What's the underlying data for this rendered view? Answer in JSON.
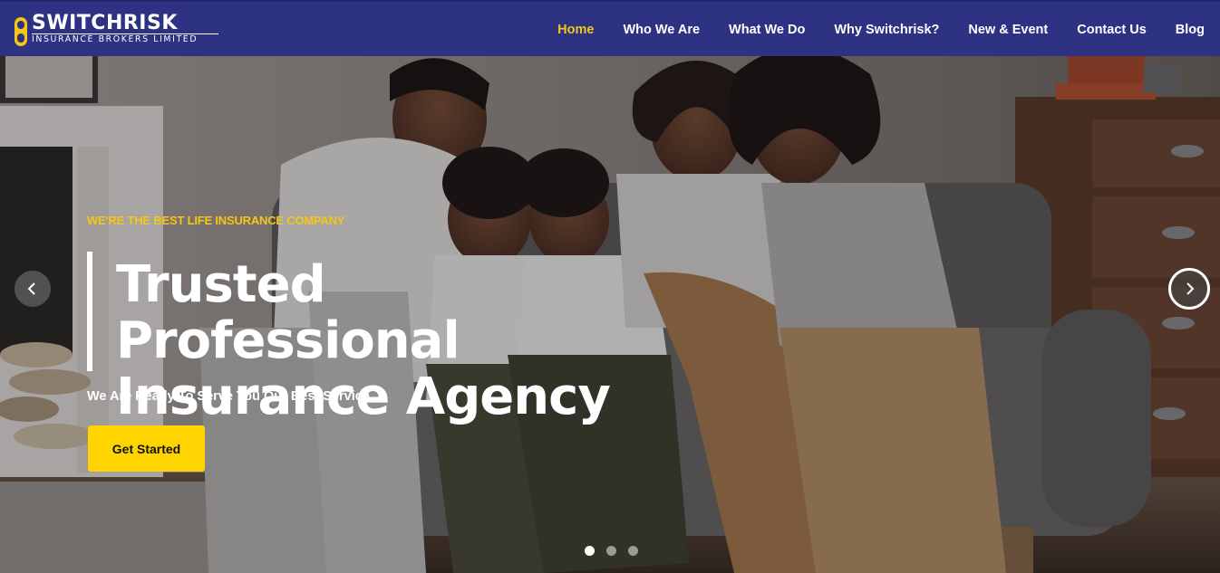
{
  "brand": {
    "name": "SWITCHRISK",
    "subtitle": "INSURANCE BROKERS LIMITED",
    "colors": {
      "navbar": "#2d3282",
      "accent": "#f5c518",
      "cta": "#ffd400"
    }
  },
  "nav": {
    "items": [
      {
        "label": "Home",
        "active": true
      },
      {
        "label": "Who We Are",
        "active": false
      },
      {
        "label": "What We Do",
        "active": false
      },
      {
        "label": "Why Switchrisk?",
        "active": false
      },
      {
        "label": "New & Event",
        "active": false
      },
      {
        "label": "Contact Us",
        "active": false
      },
      {
        "label": "Blog",
        "active": false
      }
    ]
  },
  "hero": {
    "tagline": "WE'RE THE BEST LIFE INSURANCE COMPANY",
    "title_line1": "Trusted Professional",
    "title_line2": "Insurance Agency",
    "subtitle": "We Are Ready To Serve You Our Best Service",
    "cta_label": "Get Started",
    "prev_icon": "chevron-left-icon",
    "next_icon": "chevron-right-icon",
    "slide_count": 3,
    "active_slide": 1
  }
}
